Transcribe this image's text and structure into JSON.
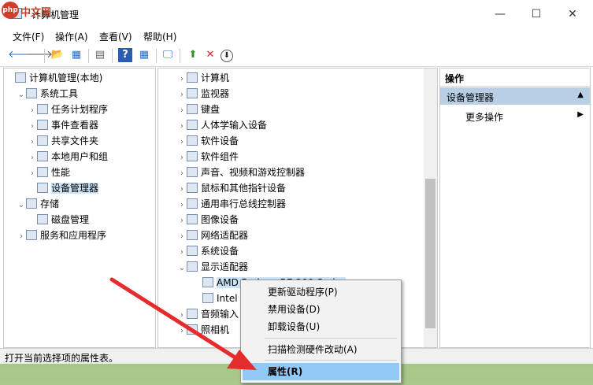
{
  "watermark": {
    "logo": "php",
    "text": "中文网"
  },
  "window": {
    "title": "计算机管理",
    "minimize": "—",
    "maximize": "☐",
    "close": "✕"
  },
  "menu": [
    "文件(F)",
    "操作(A)",
    "查看(V)",
    "帮助(H)"
  ],
  "toolbar": {
    "back": "🡐",
    "forward": "🡒",
    "up": "📂",
    "tree": "▦",
    "export": "▤",
    "help": "?",
    "props": "▦",
    "monitor": "🖵",
    "update": "⬆",
    "remove": "✕",
    "download": "⬇"
  },
  "left_tree": [
    {
      "label": "计算机管理(本地)",
      "caret": "",
      "indent": 0,
      "icon": "computer-management-icon"
    },
    {
      "label": "系统工具",
      "caret": "⌄",
      "indent": 1,
      "icon": "tools-icon"
    },
    {
      "label": "任务计划程序",
      "caret": "›",
      "indent": 2,
      "icon": "clock-icon"
    },
    {
      "label": "事件查看器",
      "caret": "›",
      "indent": 2,
      "icon": "event-icon"
    },
    {
      "label": "共享文件夹",
      "caret": "›",
      "indent": 2,
      "icon": "share-folder-icon"
    },
    {
      "label": "本地用户和组",
      "caret": "›",
      "indent": 2,
      "icon": "users-icon"
    },
    {
      "label": "性能",
      "caret": "›",
      "indent": 2,
      "icon": "performance-icon"
    },
    {
      "label": "设备管理器",
      "caret": "",
      "indent": 2,
      "icon": "device-manager-icon",
      "selected": true
    },
    {
      "label": "存储",
      "caret": "⌄",
      "indent": 1,
      "icon": "storage-icon"
    },
    {
      "label": "磁盘管理",
      "caret": "",
      "indent": 2,
      "icon": "disk-icon"
    },
    {
      "label": "服务和应用程序",
      "caret": "›",
      "indent": 1,
      "icon": "services-icon"
    }
  ],
  "device_tree": [
    {
      "label": "计算机",
      "caret": "›",
      "icon": "computer-icon"
    },
    {
      "label": "监视器",
      "caret": "›",
      "icon": "monitor-icon"
    },
    {
      "label": "键盘",
      "caret": "›",
      "icon": "keyboard-icon"
    },
    {
      "label": "人体学输入设备",
      "caret": "›",
      "icon": "hid-icon"
    },
    {
      "label": "软件设备",
      "caret": "›",
      "icon": "software-device-icon"
    },
    {
      "label": "软件组件",
      "caret": "›",
      "icon": "software-component-icon"
    },
    {
      "label": "声音、视频和游戏控制器",
      "caret": "›",
      "icon": "speaker-icon"
    },
    {
      "label": "鼠标和其他指针设备",
      "caret": "›",
      "icon": "mouse-icon"
    },
    {
      "label": "通用串行总线控制器",
      "caret": "›",
      "icon": "usb-icon"
    },
    {
      "label": "图像设备",
      "caret": "›",
      "icon": "camera-icon"
    },
    {
      "label": "网络适配器",
      "caret": "›",
      "icon": "network-icon"
    },
    {
      "label": "系统设备",
      "caret": "›",
      "icon": "system-device-icon"
    },
    {
      "label": "显示适配器",
      "caret": "⌄",
      "icon": "display-adapter-icon"
    },
    {
      "label": "AMD Radeon R7 200 Series",
      "caret": "",
      "icon": "gpu-icon",
      "child": true,
      "selected": true
    },
    {
      "label": "Intel",
      "caret": "",
      "icon": "gpu-icon",
      "child": true
    },
    {
      "label": "音频输入",
      "caret": "›",
      "icon": "audio-input-icon"
    },
    {
      "label": "照相机",
      "caret": "›",
      "icon": "webcam-icon"
    }
  ],
  "actions": {
    "header": "操作",
    "section": "设备管理器",
    "section_caret": "▲",
    "more": "更多操作",
    "more_caret": "▶"
  },
  "status": "打开当前选择项的属性表。",
  "context_menu": [
    {
      "label": "更新驱动程序(P)"
    },
    {
      "label": "禁用设备(D)"
    },
    {
      "label": "卸载设备(U)"
    },
    {
      "label": "扫描检测硬件改动(A)"
    },
    {
      "label": "属性(R)",
      "selected": true
    }
  ],
  "colors": {
    "accent": "#0078d7",
    "highlight": "#91c9f7",
    "arrow": "#e52b2b"
  }
}
